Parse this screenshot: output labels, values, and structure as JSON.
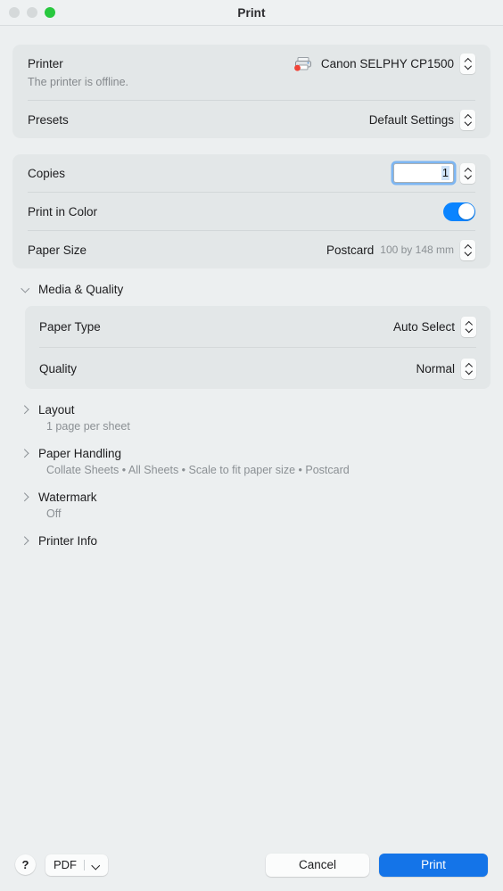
{
  "window": {
    "title": "Print",
    "traffic_lights": [
      "close-disabled",
      "minimize-disabled",
      "zoom-green"
    ]
  },
  "printer_section": {
    "printer_label": "Printer",
    "printer_value": "Canon SELPHY CP1500",
    "printer_icon": "printer-offline-icon",
    "status_text": "The printer is offline.",
    "presets_label": "Presets",
    "presets_value": "Default Settings"
  },
  "options_section": {
    "copies_label": "Copies",
    "copies_value": "1",
    "print_in_color_label": "Print in Color",
    "print_in_color_state": "on",
    "paper_size_label": "Paper Size",
    "paper_size_value": "Postcard",
    "paper_size_dimensions": "100 by 148 mm"
  },
  "sections": [
    {
      "title": "Media & Quality",
      "expanded": true,
      "subtitle": "",
      "rows": [
        {
          "label": "Paper Type",
          "value": "Auto Select"
        },
        {
          "label": "Quality",
          "value": "Normal"
        }
      ]
    },
    {
      "title": "Layout",
      "expanded": false,
      "subtitle": "1 page per sheet",
      "rows": []
    },
    {
      "title": "Paper Handling",
      "expanded": false,
      "subtitle": "Collate Sheets • All Sheets • Scale to fit paper size • Postcard",
      "rows": []
    },
    {
      "title": "Watermark",
      "expanded": false,
      "subtitle": "Off",
      "rows": []
    },
    {
      "title": "Printer Info",
      "expanded": false,
      "subtitle": "",
      "rows": []
    }
  ],
  "footer": {
    "help_label": "?",
    "pdf_label": "PDF",
    "cancel_label": "Cancel",
    "print_label": "Print"
  },
  "colors": {
    "accent_blue": "#1474e8",
    "toggle_on": "#0a84ff",
    "window_bg": "#eceff0",
    "card_bg": "#e3e7e8",
    "secondary_text": "#8b9094",
    "green_light": "#28c83f",
    "offline_dot": "#f04438"
  }
}
